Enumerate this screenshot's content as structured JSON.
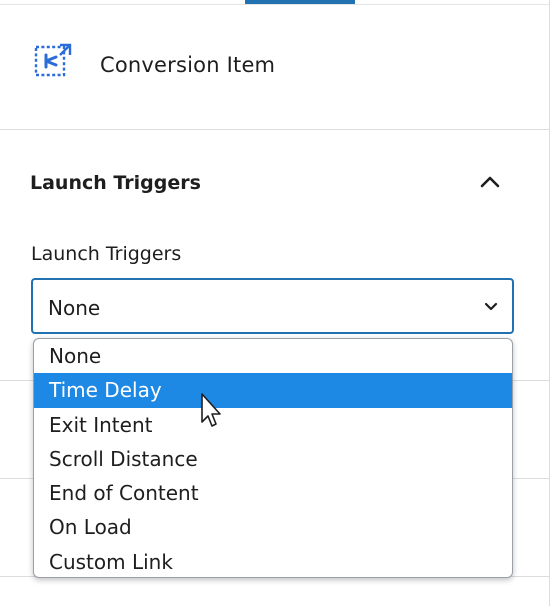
{
  "block": {
    "title": "Conversion Item",
    "icon": "conversion-item-icon"
  },
  "section": {
    "title": "Launch Triggers",
    "expanded": true,
    "toggle_icon": "chevron-up-icon"
  },
  "field": {
    "label": "Launch Triggers",
    "value": "None",
    "options": [
      {
        "label": "None"
      },
      {
        "label": "Time Delay",
        "highlighted": true
      },
      {
        "label": "Exit Intent"
      },
      {
        "label": "Scroll Distance"
      },
      {
        "label": "End of Content"
      },
      {
        "label": "On Load"
      },
      {
        "label": "Custom Link"
      }
    ]
  },
  "colors": {
    "accent": "#2271b1",
    "highlight": "#1e88e5"
  }
}
